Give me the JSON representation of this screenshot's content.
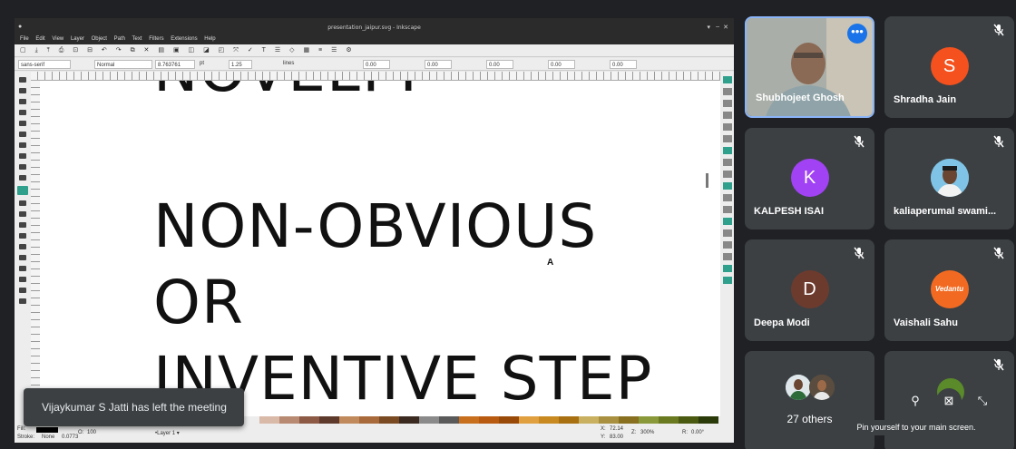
{
  "inkscape": {
    "window_title": "presentation_jaipur.svg - Inkscape",
    "menu": [
      "File",
      "Edit",
      "View",
      "Layer",
      "Object",
      "Path",
      "Text",
      "Filters",
      "Extensions",
      "Help"
    ],
    "text_toolbar": {
      "font_family": "sans-serif",
      "font_style": "Normal",
      "font_size": "8.763761",
      "unit": "pt",
      "line_height": "1.25",
      "line_unit": "lines",
      "spacing_values": [
        "0.00",
        "0.00",
        "0.00",
        "0.00",
        "0.00"
      ]
    },
    "canvas_text": {
      "top_partial": "NOVELTY",
      "line1": "NON-OBVIOUS",
      "line2": "OR",
      "line3": "INVENTIVE STEP"
    },
    "status": {
      "fill_label": "Fill:",
      "stroke_label": "Stroke:",
      "stroke_value": "None",
      "stroke_width": "0.0773",
      "opacity_label": "O:",
      "opacity_value": "100",
      "layer": "•Layer 1 ▾",
      "x_label": "X:",
      "x_value": "72.14",
      "y_label": "Y:",
      "y_value": "83.00",
      "zoom_label": "Z:",
      "zoom_value": "300%",
      "rotation_label": "R:",
      "rotation_value": "0.00°"
    },
    "palette": [
      "#d9b9a8",
      "#b88a72",
      "#8c5a45",
      "#5e3a2c",
      "#c08a5c",
      "#a86a3a",
      "#7a4a22",
      "#3a2a20",
      "#8a8a8a",
      "#5a5a5a",
      "#c86f1e",
      "#b85a10",
      "#9a4a08",
      "#e0a040",
      "#c88a20",
      "#a87010",
      "#c8b060",
      "#a89040",
      "#887020",
      "#8a9a3a",
      "#6a7a20",
      "#4a5a10",
      "#2a3a08"
    ]
  },
  "toast": {
    "message": "Vijaykumar S Jatti has left the meeting"
  },
  "participants": [
    {
      "name": "Shubhojeet Ghosh",
      "type": "video",
      "self": true
    },
    {
      "name": "Shradha Jain",
      "initial": "S",
      "color": "#f4511e",
      "muted": true
    },
    {
      "name": "KALPESH ISAI",
      "initial": "K",
      "color": "#a142f4",
      "muted": true
    },
    {
      "name": "kaliaperumal swami...",
      "type": "photo",
      "muted": true
    },
    {
      "name": "Deepa Modi",
      "initial": "D",
      "color": "#6d3b2e",
      "muted": true
    },
    {
      "name": "Vaishali Sahu",
      "logo_text": "Vedantu",
      "color": "#f26a21",
      "muted": true
    },
    {
      "others_label": "27 others"
    }
  ],
  "pin_tooltip": "Pin yourself to your main screen.",
  "icons": {
    "mic_off": "mic-off-icon",
    "more": "more-options-icon",
    "pin": "pin-icon",
    "remove_from_grid": "grid-remove-icon",
    "minimize": "minimize-icon"
  }
}
